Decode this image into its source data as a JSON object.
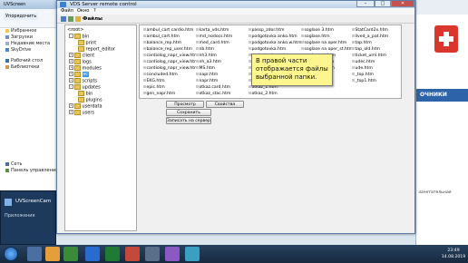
{
  "window": {
    "title": "VDS Server remote control",
    "menu": [
      "Файл",
      "Окно",
      "?"
    ],
    "toolbar_label": "Файлы",
    "controls": {
      "minimize": "–",
      "maximize": "□",
      "close": "✕"
    }
  },
  "tree": [
    {
      "label": "<root>",
      "depth": 0
    },
    {
      "label": "bin",
      "depth": 1
    },
    {
      "label": "print",
      "depth": 2
    },
    {
      "label": "report_editor",
      "depth": 2
    },
    {
      "label": "client",
      "depth": 1
    },
    {
      "label": "logs",
      "depth": 1
    },
    {
      "label": "modules",
      "depth": 1
    },
    {
      "label": "sc",
      "depth": 1,
      "selected": true
    },
    {
      "label": "scripts",
      "depth": 1
    },
    {
      "label": "updates",
      "depth": 1
    },
    {
      "label": "bin",
      "depth": 2
    },
    {
      "label": "plugins",
      "depth": 2
    },
    {
      "label": "userdata",
      "depth": 1
    },
    {
      "label": "users",
      "depth": 1
    }
  ],
  "files": [
    [
      "ambul_cart cardio.htm",
      "ambul_cart.htm",
      "balance_rep.htm",
      "balance_rep_user.htm",
      "cardiolog_napr_view.htm",
      "cardiolog_napr_view.htm",
      "cardiolog_napr_view.htm",
      "concluded.htm",
      "EKG.htm",
      "epic.htm",
      "gen_napr.htm"
    ],
    [
      "karta_vds.htm",
      "md_nodocs.htm",
      "med_card.htm",
      "nb.htm",
      "nh3.htm",
      "nh_a3.htm",
      "MS.htm",
      "napr.htm",
      "napr.htm",
      "otkaz.card.htm",
      "otkaz_stac.htm"
    ],
    [
      "passp_zdor.htm",
      "podgotovka anko.htm",
      "podgotovka anko.w.htm",
      "podgotovka.htm",
      "podgotovka_st.htm",
      "podgotovka_2.htm",
      "podgotovka_3.htm",
      "podgotovka_4.htm",
      "podgotovka_5.htm",
      "otkaz_1.htm",
      "otkaz_2.htm"
    ],
    [
      "soglase 3.htm",
      "soglase.htm",
      "soglase na oper.htm",
      "soglase na oper_st.htm",
      "soglase_st.htm",
      "soglase_v.htm",
      "soglase_3.htm"
    ],
    [
      "StatCard2x.htm",
      "lived_a_pat.htm",
      "tap.htm",
      "tap_old.htm",
      "ticket_uml.htm",
      "udec.htm",
      "ude.htm",
      "_top.htm",
      "_top1.htm"
    ]
  ],
  "buttons": {
    "preview": "Просмотр",
    "properties": "Свойства",
    "save_local": "Сохранить локально",
    "write_server": "Записать на сервер"
  },
  "callout": {
    "line1": "В правой части",
    "line2": "отображается файлы",
    "line3": "выбранной папки."
  },
  "background": {
    "explorer_title": "UVScreen",
    "organize": "Упорядочить",
    "favorites": "Избранное",
    "downloads": "Загрузки",
    "recent": "Недавние места",
    "skydrive": "SkyDrive",
    "desktop": "Рабочий стол",
    "libraries": "Библиотеки",
    "network": "Сеть",
    "control_panel": "Панель управления",
    "taskbar_window": "UVScreenCam",
    "taskbar_sub": "Приложения",
    "right_caption": "ОЧНИКИ",
    "right_note": "Зачетательная"
  },
  "clock": {
    "time": "23:49",
    "date": "14.08.2019"
  }
}
